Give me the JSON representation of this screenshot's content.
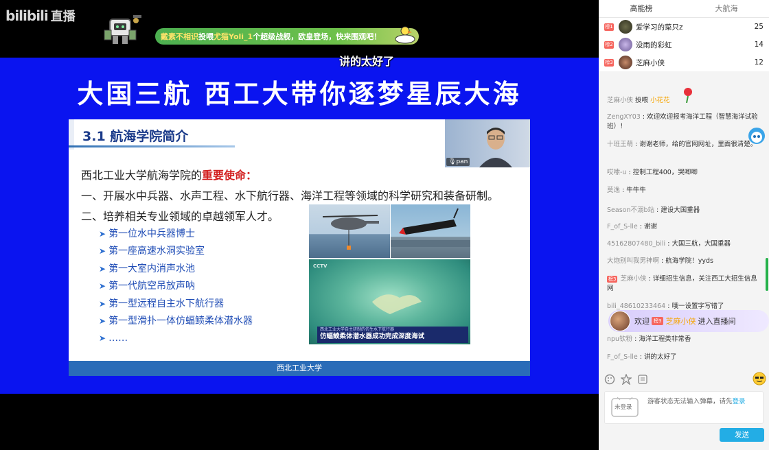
{
  "video": {
    "logo": "bilibili",
    "logo_live": "直播",
    "gift_banner": {
      "name_prefix": "戴素不相识",
      "text_mid": "投喂",
      "target": "尤猫Yoli_1",
      "text_tail": "个超级战舰，欧皇登场，快来围观吧！"
    },
    "danmaku": "讲的太好了",
    "slide_banner": "大国三航  西工大带你逐梦星辰大海",
    "slide": {
      "section_title": "3.1 航海学院简介",
      "intro_prefix": "西北工业大学航海学院的",
      "intro_highlight": "重要使命：",
      "line1": "一、开展水中兵器、水声工程、水下航行器、海洋工程等领域的科学研究和装备研制。",
      "line2": "二、培养相关专业领域的卓越领军人才。",
      "firsts": [
        "第一位水中兵器博士",
        "第一座高速水洞实验室",
        "第一大室内消声水池",
        "第一代航空吊放声呐",
        "第一型远程自主水下航行器",
        "第一型滑扑一体仿蝠鲼柔体潜水器",
        "……"
      ],
      "news_top": "西北工业大学自主研制的仿生水下航行器",
      "news_headline": "仿蝠鲼柔体潜水器成功完成深度海试",
      "footer": "西北工业大学",
      "camera_name": "pan"
    }
  },
  "panel": {
    "tabs": [
      "高能榜",
      "大航海"
    ],
    "rank": [
      {
        "badge": "榜1",
        "name": "爱学习的菜只z",
        "score": "25"
      },
      {
        "badge": "榜2",
        "name": "没雨的彩虹",
        "score": "14"
      },
      {
        "badge": "榜3",
        "name": "芝麻小侠",
        "score": "12"
      }
    ],
    "chat": [
      {
        "user": "芝麻小侠",
        "text": "投喂",
        "gift": "小花花"
      },
      {
        "user": "ZengXY03",
        "text": "欢迎欢迎报考海洋工程（智慧海洋试验班）！"
      },
      {
        "user": "十班王萌",
        "text": "谢谢老师，给的官网网址，里面很清楚。"
      },
      {
        "user": "哎嗦-u",
        "text": "控制工程400，哭唧唧"
      },
      {
        "user": "莫逸",
        "text": "牛牛牛"
      },
      {
        "user": "Season不溺b站",
        "text": "建设大国重器"
      },
      {
        "user": "F_of_S-lle",
        "text": "谢谢"
      },
      {
        "user": "45162807480_bili",
        "text": "大国三航，大国重器"
      },
      {
        "user": "大炮别叫我男神啊",
        "text": "航海学院！yyds"
      },
      {
        "user": "芝麻小侠",
        "text": "详细招生信息，关注西工大招生信息网",
        "badge": "榜3"
      },
      {
        "user": "bili_48610233464",
        "text": "哦一设置字写错了"
      },
      {
        "user": "npu钦粉",
        "text": "海洋工程类非常香"
      },
      {
        "user": "F_of_S-lle",
        "text": "讲的太好了"
      }
    ],
    "welcome": {
      "prefix": "欢迎",
      "badge": "榜3",
      "name": "芝麻小侠",
      "suffix": "进入直播间"
    },
    "input": {
      "not_logged": "未登录",
      "hint": "游客状态无法输入弹幕，请先",
      "login_link": "登录"
    },
    "send_label": "发送"
  }
}
